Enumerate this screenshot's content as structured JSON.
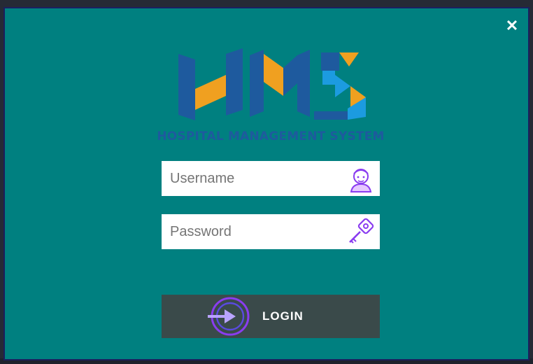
{
  "window": {
    "close_glyph": "✕"
  },
  "logo": {
    "subtitle": "HOSPITAL MANAGEMENT SYSTEM"
  },
  "form": {
    "username_placeholder": "Username",
    "password_placeholder": "Password",
    "login_label": "LOGIN"
  },
  "colors": {
    "dialog_bg": "#008080",
    "logo_blue": "#1e5a9e",
    "logo_orange": "#f0a020",
    "logo_cyan": "#1c9be0",
    "button_bg": "#3a4a4a",
    "icon_accent": "#8a3cf0"
  }
}
